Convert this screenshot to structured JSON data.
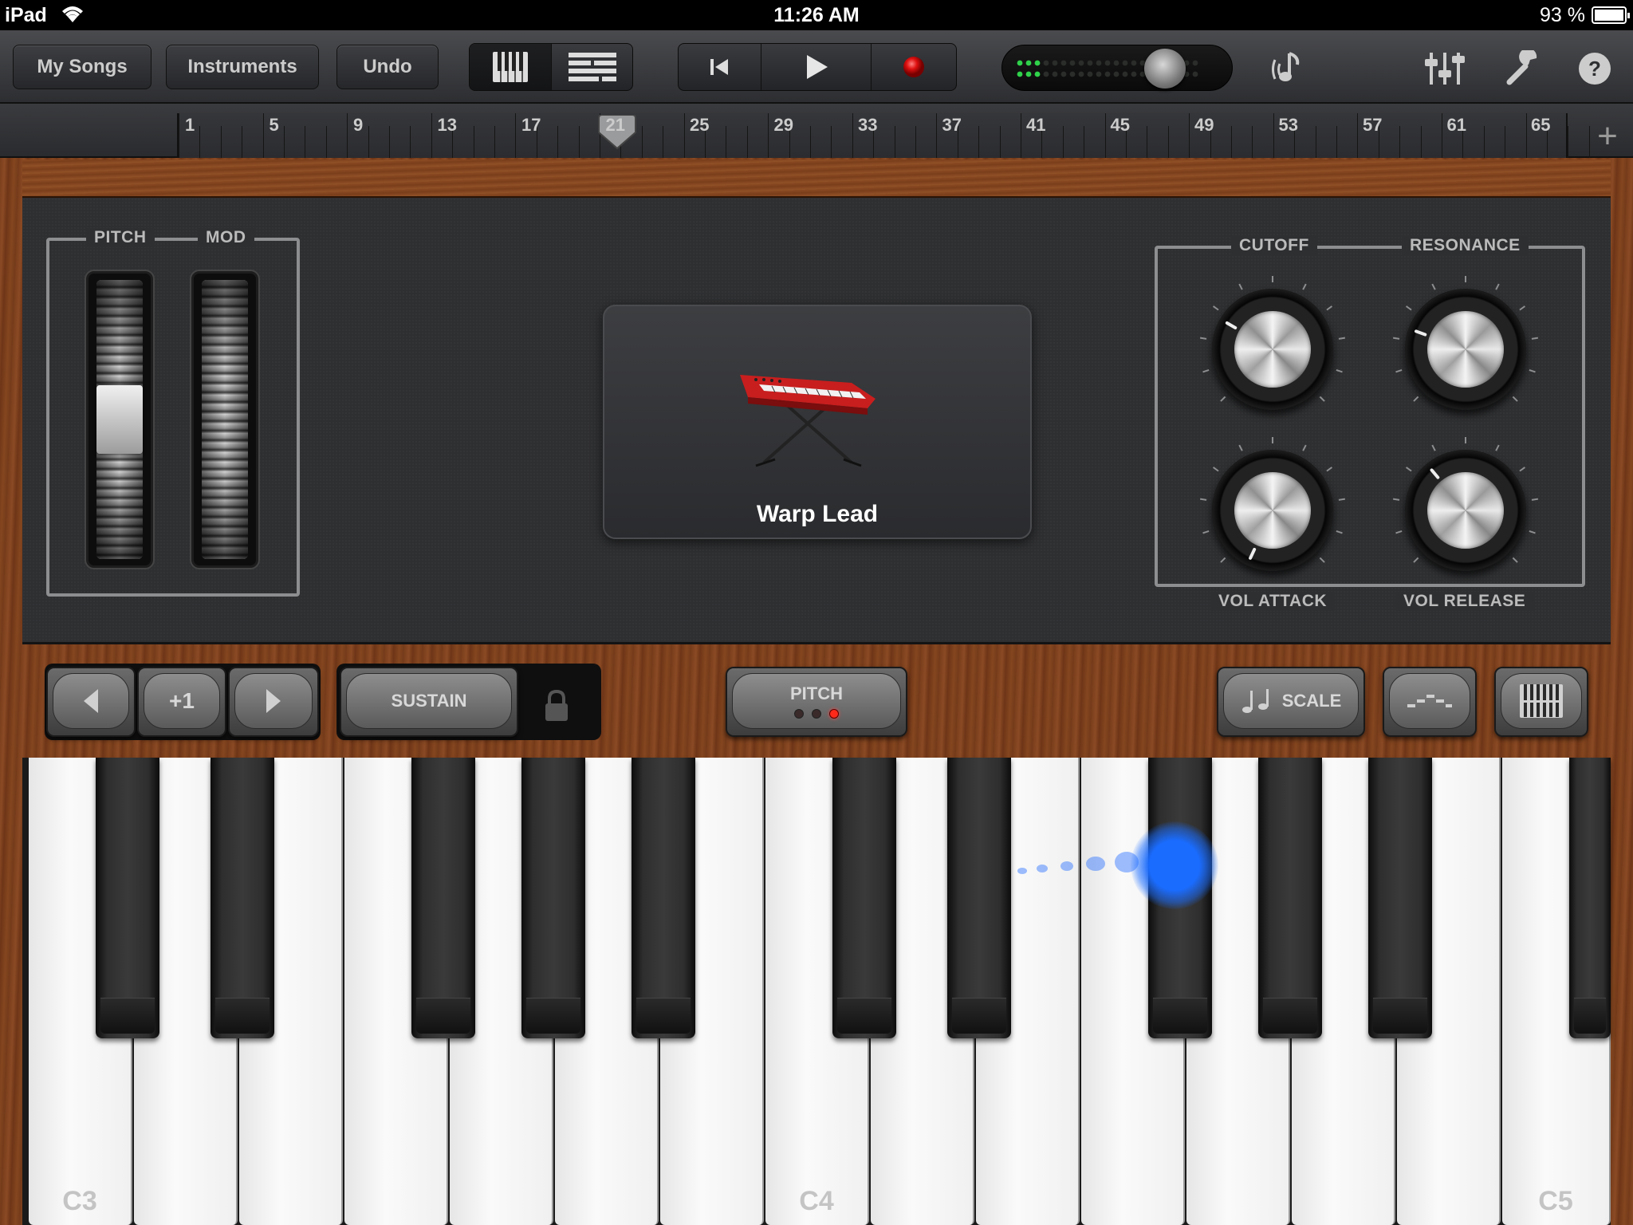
{
  "status_bar": {
    "device": "iPad",
    "time": "11:26 AM",
    "battery": "93 %"
  },
  "toolbar": {
    "my_songs": "My Songs",
    "instruments": "Instruments",
    "undo": "Undo",
    "icons": [
      "keyboard-view-icon",
      "tracks-view-icon",
      "rewind-icon",
      "play-icon",
      "record-icon",
      "metronome-icon",
      "mixer-icon",
      "settings-wrench-icon",
      "help-icon"
    ]
  },
  "ruler": {
    "bars": [
      "1",
      "5",
      "9",
      "13",
      "17",
      "21",
      "25",
      "29",
      "33",
      "37",
      "41",
      "45",
      "49",
      "53",
      "57",
      "61",
      "65"
    ],
    "add": "+"
  },
  "instrument": {
    "pitch_label": "PITCH",
    "mod_label": "MOD",
    "preset_name": "Warp Lead",
    "knobs": {
      "cutoff": "CUTOFF",
      "resonance": "RESONANCE",
      "vol_attack": "VOL ATTACK",
      "vol_release": "VOL RELEASE"
    }
  },
  "controls": {
    "octave": "+1",
    "sustain": "SUSTAIN",
    "pitch": "PITCH",
    "scale": "SCALE"
  },
  "keyboard": {
    "labels": [
      "C3",
      "C4",
      "C5"
    ]
  },
  "colors": {
    "record": "#e01010",
    "touch": "#1a6cff",
    "level_led": "#2fd24a"
  }
}
